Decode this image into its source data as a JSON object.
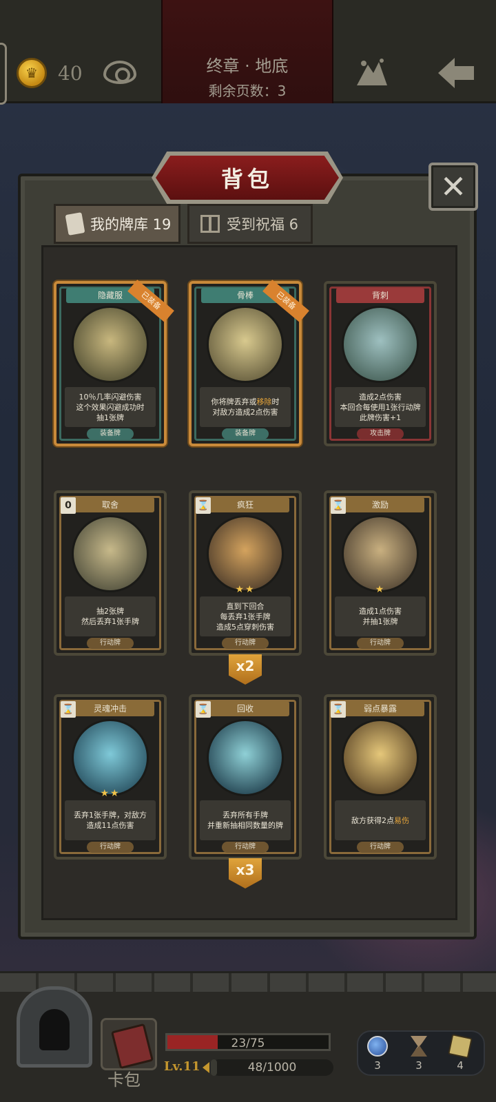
{
  "top": {
    "coins": "40",
    "chapter": "终章 · 地底",
    "pages_left": "剩余页数：3"
  },
  "panel": {
    "title": "背包",
    "close": "✕",
    "tabs": [
      {
        "label": "我的牌库 19",
        "active": true
      },
      {
        "label": "受到祝福 6",
        "active": false
      }
    ]
  },
  "cards": [
    {
      "name": "隐藏服",
      "cost": "",
      "equipped": "已装备",
      "stars": "",
      "text": [
        "10％几率闪避伤害",
        "这个效果闪避成功时",
        "抽1张牌"
      ],
      "highlight": "",
      "type": "装备牌",
      "count": ""
    },
    {
      "name": "骨棒",
      "cost": "",
      "equipped": "已装备",
      "stars": "",
      "text": [
        "你将牌丢弃或移除时",
        "对敌方造成2点伤害"
      ],
      "highlight": "移除",
      "type": "装备牌",
      "count": ""
    },
    {
      "name": "背刺",
      "cost": "",
      "equipped": "",
      "stars": "",
      "text": [
        "造成2点伤害",
        "本回合每使用1张行动牌",
        "此牌伤害+1"
      ],
      "highlight": "",
      "type": "攻击牌",
      "count": ""
    },
    {
      "name": "取舍",
      "cost": "0",
      "equipped": "",
      "stars": "",
      "text": [
        "抽2张牌",
        "然后丢弃1张手牌"
      ],
      "highlight": "",
      "type": "行动牌",
      "count": ""
    },
    {
      "name": "疯狂",
      "cost": "⌛",
      "equipped": "",
      "stars": "★★",
      "text": [
        "直到下回合",
        "每丢弃1张手牌",
        "造成5点穿刺伤害"
      ],
      "highlight": "",
      "type": "行动牌",
      "count": "x2"
    },
    {
      "name": "激励",
      "cost": "⌛",
      "equipped": "",
      "stars": "★",
      "text": [
        "造成1点伤害",
        "并抽1张牌"
      ],
      "highlight": "",
      "type": "行动牌",
      "count": ""
    },
    {
      "name": "灵魂冲击",
      "cost": "⌛",
      "equipped": "",
      "stars": "★★",
      "text": [
        "丢弃1张手牌，对敌方",
        "造成11点伤害"
      ],
      "highlight": "",
      "type": "行动牌",
      "count": ""
    },
    {
      "name": "回收",
      "cost": "⌛",
      "equipped": "",
      "stars": "",
      "text": [
        "丢弃所有手牌",
        "并重新抽相同数量的牌"
      ],
      "highlight": "",
      "type": "行动牌",
      "count": "x3"
    },
    {
      "name": "弱点暴露",
      "cost": "⌛",
      "equipped": "",
      "stars": "",
      "text": [
        "敌方获得2点易伤"
      ],
      "highlight": "易伤",
      "type": "行动牌",
      "count": ""
    }
  ],
  "bottom": {
    "card_pack": "卡包",
    "hp": "23/75",
    "hp_fraction": 0.31,
    "level": "Lv.11",
    "xp": "48/1000",
    "xp_fraction": 0.048,
    "resources": [
      {
        "icon": "potion-icon",
        "value": "3"
      },
      {
        "icon": "hourglass-icon",
        "value": "3"
      },
      {
        "icon": "cards-icon",
        "value": "4"
      }
    ]
  },
  "colors": {
    "accent_red": "#8a1d1d",
    "gold": "#c4962e",
    "equip_border": "#c98a3a",
    "highlight": "#e8a63a"
  }
}
